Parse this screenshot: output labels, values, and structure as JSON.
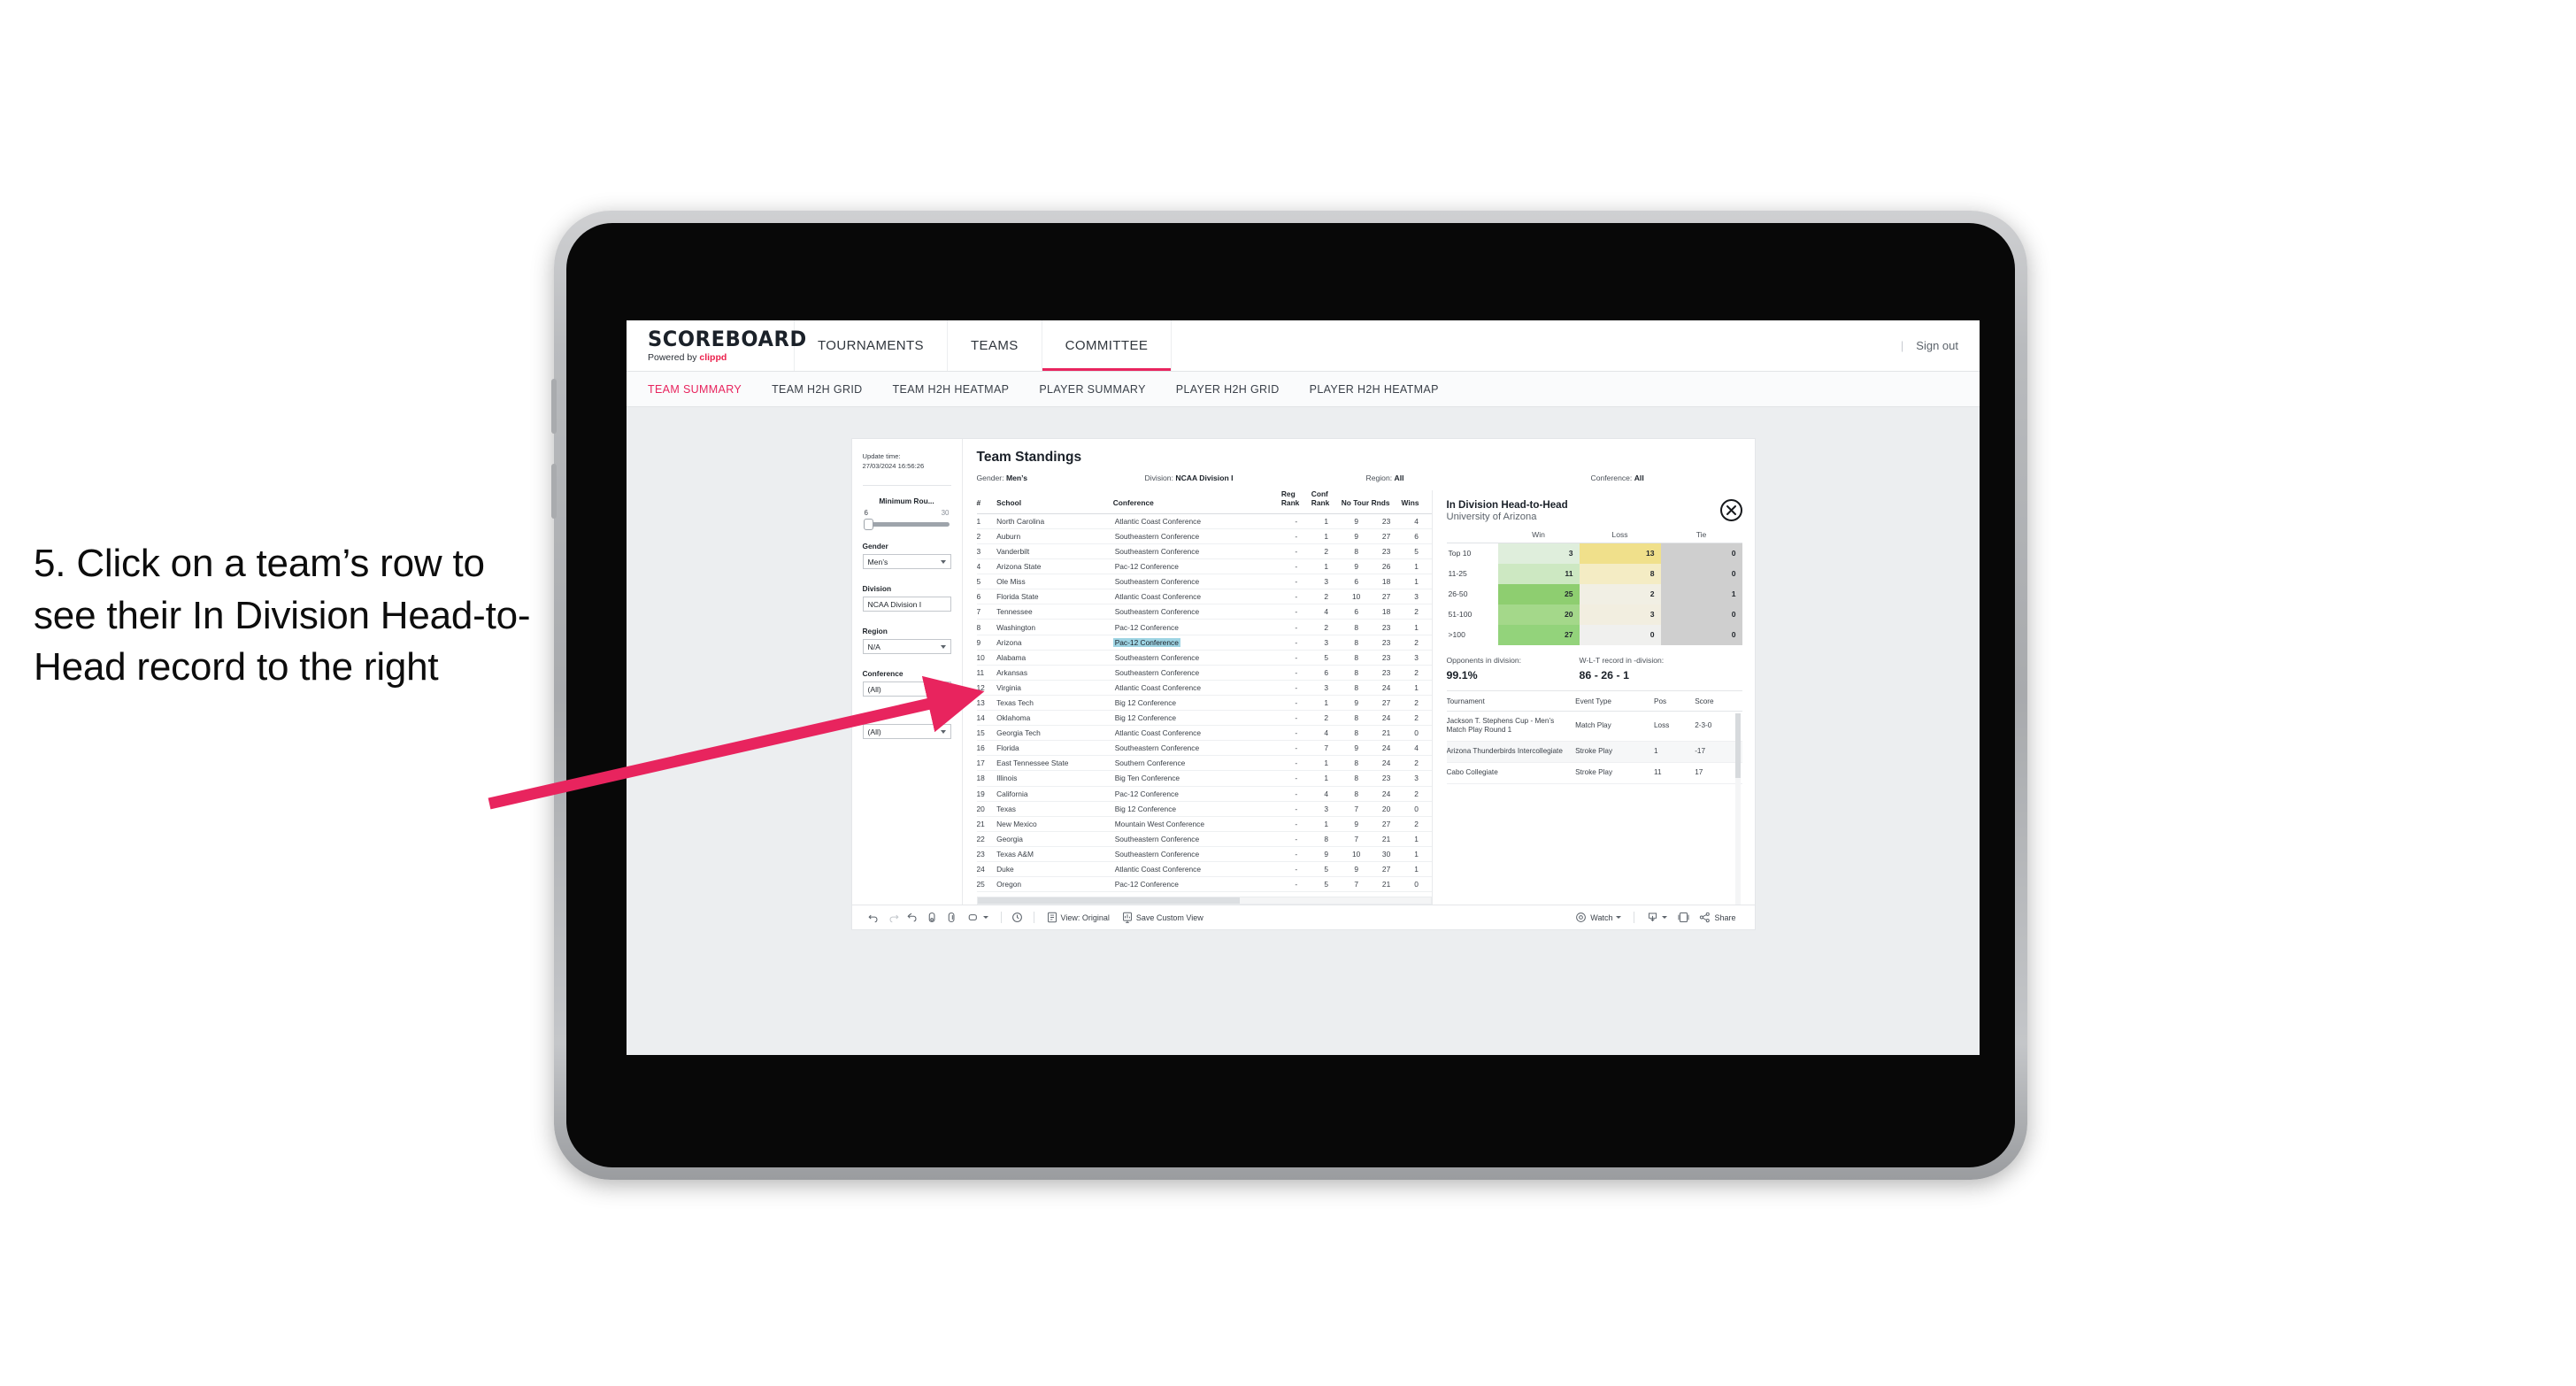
{
  "caption": {
    "text": "5. Click on a team’s row to see their In Division Head-to-Head record to the right"
  },
  "colors": {
    "accent": "#e8245e",
    "arrow": "#e8245e",
    "selected_row": "#9ed4e3",
    "brand_red": "#eb1f4b"
  },
  "topnav": {
    "brand_title": "SCOREBOARD",
    "brand_sub_prefix": "Powered by ",
    "brand_sub_name": "clippd",
    "items": [
      {
        "label": "TOURNAMENTS",
        "active": false
      },
      {
        "label": "TEAMS",
        "active": false
      },
      {
        "label": "COMMITTEE",
        "active": true
      }
    ],
    "separator": "|",
    "sign_out": "Sign out"
  },
  "subnav": {
    "items": [
      {
        "label": "TEAM SUMMARY",
        "active": true
      },
      {
        "label": "TEAM H2H GRID",
        "active": false
      },
      {
        "label": "TEAM H2H HEATMAP",
        "active": false
      },
      {
        "label": "PLAYER SUMMARY",
        "active": false
      },
      {
        "label": "PLAYER H2H GRID",
        "active": false
      },
      {
        "label": "PLAYER H2H HEATMAP",
        "active": false
      }
    ]
  },
  "filters": {
    "update_time_label": "Update time:",
    "update_time_value": "27/03/2024 16:56:26",
    "min_rounds": {
      "title": "Minimum Rou...",
      "min": "6",
      "max": "30"
    },
    "gender": {
      "title": "Gender",
      "value": "Men’s"
    },
    "division": {
      "title": "Division",
      "value": "NCAA Division I"
    },
    "region": {
      "title": "Region",
      "value": "N/A"
    },
    "conference": {
      "title": "Conference",
      "value": "(All)"
    },
    "school": {
      "title": "School",
      "value": "(All)"
    }
  },
  "standings": {
    "title": "Team Standings",
    "summary": [
      {
        "label": "Gender: ",
        "value": "Men’s"
      },
      {
        "label": "Division: ",
        "value": "NCAA Division I"
      },
      {
        "label": "Region: ",
        "value": "All"
      },
      {
        "label": "Conference: ",
        "value": "All"
      }
    ],
    "columns": [
      "#",
      "School",
      "Conference",
      "Reg Rank",
      "Conf Rank",
      "No Tour",
      "Rnds",
      "Wins"
    ],
    "rows": [
      {
        "rank": "1",
        "school": "North Carolina",
        "conference": "Atlantic Coast Conference",
        "reg_rank": "-",
        "conf_rank": "1",
        "no_tour": "9",
        "rnds": "23",
        "wins": "4",
        "selected": false
      },
      {
        "rank": "2",
        "school": "Auburn",
        "conference": "Southeastern Conference",
        "reg_rank": "-",
        "conf_rank": "1",
        "no_tour": "9",
        "rnds": "27",
        "wins": "6",
        "selected": false
      },
      {
        "rank": "3",
        "school": "Vanderbilt",
        "conference": "Southeastern Conference",
        "reg_rank": "-",
        "conf_rank": "2",
        "no_tour": "8",
        "rnds": "23",
        "wins": "5",
        "selected": false
      },
      {
        "rank": "4",
        "school": "Arizona State",
        "conference": "Pac-12 Conference",
        "reg_rank": "-",
        "conf_rank": "1",
        "no_tour": "9",
        "rnds": "26",
        "wins": "1",
        "selected": false
      },
      {
        "rank": "5",
        "school": "Ole Miss",
        "conference": "Southeastern Conference",
        "reg_rank": "-",
        "conf_rank": "3",
        "no_tour": "6",
        "rnds": "18",
        "wins": "1",
        "selected": false
      },
      {
        "rank": "6",
        "school": "Florida State",
        "conference": "Atlantic Coast Conference",
        "reg_rank": "-",
        "conf_rank": "2",
        "no_tour": "10",
        "rnds": "27",
        "wins": "3",
        "selected": false
      },
      {
        "rank": "7",
        "school": "Tennessee",
        "conference": "Southeastern Conference",
        "reg_rank": "-",
        "conf_rank": "4",
        "no_tour": "6",
        "rnds": "18",
        "wins": "2",
        "selected": false
      },
      {
        "rank": "8",
        "school": "Washington",
        "conference": "Pac-12 Conference",
        "reg_rank": "-",
        "conf_rank": "2",
        "no_tour": "8",
        "rnds": "23",
        "wins": "1",
        "selected": false
      },
      {
        "rank": "9",
        "school": "Arizona",
        "conference": "Pac-12 Conference",
        "reg_rank": "-",
        "conf_rank": "3",
        "no_tour": "8",
        "rnds": "23",
        "wins": "2",
        "selected": true
      },
      {
        "rank": "10",
        "school": "Alabama",
        "conference": "Southeastern Conference",
        "reg_rank": "-",
        "conf_rank": "5",
        "no_tour": "8",
        "rnds": "23",
        "wins": "3",
        "selected": false
      },
      {
        "rank": "11",
        "school": "Arkansas",
        "conference": "Southeastern Conference",
        "reg_rank": "-",
        "conf_rank": "6",
        "no_tour": "8",
        "rnds": "23",
        "wins": "2",
        "selected": false
      },
      {
        "rank": "12",
        "school": "Virginia",
        "conference": "Atlantic Coast Conference",
        "reg_rank": "-",
        "conf_rank": "3",
        "no_tour": "8",
        "rnds": "24",
        "wins": "1",
        "selected": false
      },
      {
        "rank": "13",
        "school": "Texas Tech",
        "conference": "Big 12 Conference",
        "reg_rank": "-",
        "conf_rank": "1",
        "no_tour": "9",
        "rnds": "27",
        "wins": "2",
        "selected": false
      },
      {
        "rank": "14",
        "school": "Oklahoma",
        "conference": "Big 12 Conference",
        "reg_rank": "-",
        "conf_rank": "2",
        "no_tour": "8",
        "rnds": "24",
        "wins": "2",
        "selected": false
      },
      {
        "rank": "15",
        "school": "Georgia Tech",
        "conference": "Atlantic Coast Conference",
        "reg_rank": "-",
        "conf_rank": "4",
        "no_tour": "8",
        "rnds": "21",
        "wins": "0",
        "selected": false
      },
      {
        "rank": "16",
        "school": "Florida",
        "conference": "Southeastern Conference",
        "reg_rank": "-",
        "conf_rank": "7",
        "no_tour": "9",
        "rnds": "24",
        "wins": "4",
        "selected": false
      },
      {
        "rank": "17",
        "school": "East Tennessee State",
        "conference": "Southern Conference",
        "reg_rank": "-",
        "conf_rank": "1",
        "no_tour": "8",
        "rnds": "24",
        "wins": "2",
        "selected": false
      },
      {
        "rank": "18",
        "school": "Illinois",
        "conference": "Big Ten Conference",
        "reg_rank": "-",
        "conf_rank": "1",
        "no_tour": "8",
        "rnds": "23",
        "wins": "3",
        "selected": false
      },
      {
        "rank": "19",
        "school": "California",
        "conference": "Pac-12 Conference",
        "reg_rank": "-",
        "conf_rank": "4",
        "no_tour": "8",
        "rnds": "24",
        "wins": "2",
        "selected": false
      },
      {
        "rank": "20",
        "school": "Texas",
        "conference": "Big 12 Conference",
        "reg_rank": "-",
        "conf_rank": "3",
        "no_tour": "7",
        "rnds": "20",
        "wins": "0",
        "selected": false
      },
      {
        "rank": "21",
        "school": "New Mexico",
        "conference": "Mountain West Conference",
        "reg_rank": "-",
        "conf_rank": "1",
        "no_tour": "9",
        "rnds": "27",
        "wins": "2",
        "selected": false
      },
      {
        "rank": "22",
        "school": "Georgia",
        "conference": "Southeastern Conference",
        "reg_rank": "-",
        "conf_rank": "8",
        "no_tour": "7",
        "rnds": "21",
        "wins": "1",
        "selected": false
      },
      {
        "rank": "23",
        "school": "Texas A&M",
        "conference": "Southeastern Conference",
        "reg_rank": "-",
        "conf_rank": "9",
        "no_tour": "10",
        "rnds": "30",
        "wins": "1",
        "selected": false
      },
      {
        "rank": "24",
        "school": "Duke",
        "conference": "Atlantic Coast Conference",
        "reg_rank": "-",
        "conf_rank": "5",
        "no_tour": "9",
        "rnds": "27",
        "wins": "1",
        "selected": false
      },
      {
        "rank": "25",
        "school": "Oregon",
        "conference": "Pac-12 Conference",
        "reg_rank": "-",
        "conf_rank": "5",
        "no_tour": "7",
        "rnds": "21",
        "wins": "0",
        "selected": false
      }
    ]
  },
  "h2h": {
    "title": "In Division Head-to-Head",
    "subtitle": "University of Arizona",
    "close_label": "✕",
    "chart_data": {
      "type": "heatmap",
      "title": "In Division Head-to-Head",
      "columns": [
        "Win",
        "Loss",
        "Tie"
      ],
      "rows": [
        "Top 10",
        "11-25",
        "26-50",
        "51-100",
        ">100"
      ],
      "values": [
        [
          3,
          13,
          0
        ],
        [
          11,
          8,
          0
        ],
        [
          25,
          2,
          1
        ],
        [
          20,
          3,
          0
        ],
        [
          27,
          0,
          0
        ]
      ],
      "cell_colors": [
        [
          "#dfeedc",
          "#f0e08b",
          "#cfcfcf"
        ],
        [
          "#cde8c2",
          "#f4ecc4",
          "#cfcfcf"
        ],
        [
          "#8ece70",
          "#f1efe4",
          "#cfcfcf"
        ],
        [
          "#a4d88a",
          "#f2eee0",
          "#cfcfcf"
        ],
        [
          "#93d37b",
          "#f0f0ee",
          "#cfcfcf"
        ]
      ]
    },
    "stats": [
      {
        "label": "Opponents in division:",
        "value": "99.1%"
      },
      {
        "label": "W-L-T record in -division:",
        "value": "86 - 26 - 1"
      }
    ],
    "tournament_columns": [
      "Tournament",
      "Event Type",
      "Pos",
      "Score"
    ],
    "tournaments": [
      {
        "name": "Jackson T. Stephens Cup - Men’s Match Play Round 1",
        "event_type": "Match Play",
        "pos": "Loss",
        "score": "2-3-0"
      },
      {
        "name": "Arizona Thunderbirds Intercollegiate",
        "event_type": "Stroke Play",
        "pos": "1",
        "score": "-17"
      },
      {
        "name": "Cabo Collegiate",
        "event_type": "Stroke Play",
        "pos": "11",
        "score": "17"
      }
    ]
  },
  "toolbar": {
    "view_label": "View: Original",
    "save_label": "Save Custom View",
    "watch_label": "Watch",
    "share_label": "Share"
  }
}
